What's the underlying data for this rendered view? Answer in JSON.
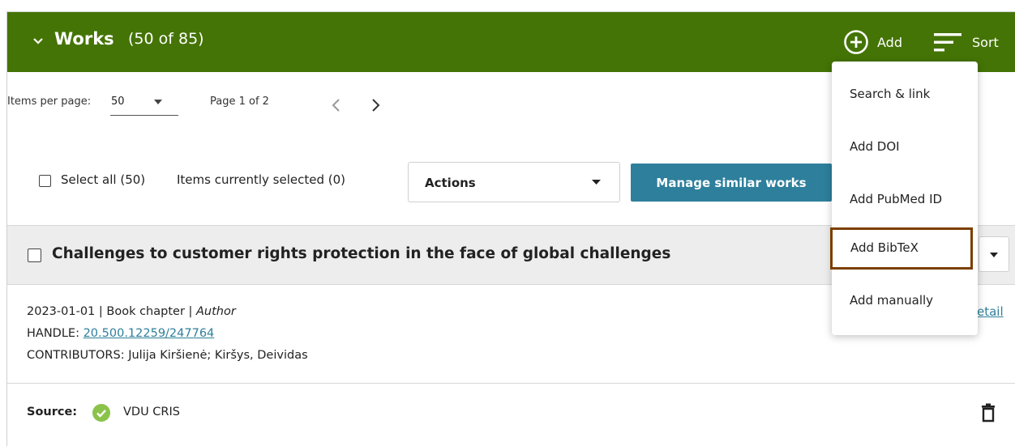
{
  "header": {
    "title": "Works",
    "count": "(50 of 85)",
    "add_label": "Add",
    "sort_label": "Sort",
    "color": "#447405"
  },
  "pagination": {
    "items_per_page_label": "Items per page:",
    "items_per_page_value": "50",
    "page_info": "Page 1 of 2"
  },
  "selection": {
    "select_all_label": "Select all (50)",
    "selected_info": "Items currently selected (0)",
    "actions_label": "Actions",
    "manage_label": "Manage similar works"
  },
  "work": {
    "title": "Challenges to customer rights protection in the face of global challenges",
    "date": "2023-01-01",
    "type": "Book chapter",
    "role": "Author",
    "handle_label": "HANDLE:",
    "handle_value": "20.500.12259/247764",
    "contributors_label": "CONTRIBUTORS:",
    "contributors": "Julija Kiršienė; Kiršys, Deividas",
    "detail_link": "etail",
    "source_label": "Source:",
    "source_name": "VDU CRIS"
  },
  "add_menu": {
    "items": [
      {
        "label": "Search & link"
      },
      {
        "label": "Add DOI"
      },
      {
        "label": "Add PubMed ID"
      },
      {
        "label": "Add BibTeX",
        "highlighted": true
      },
      {
        "label": "Add manually"
      }
    ]
  },
  "colors": {
    "link": "#2e7f9b",
    "highlight_border": "#7b3f00",
    "source_check": "#8bc34a"
  },
  "icons": [
    "chevron-down-icon",
    "add-circle-icon",
    "sort-icon",
    "chevron-left-icon",
    "chevron-right-icon",
    "caret-down-icon",
    "check-circle-icon",
    "trash-icon"
  ]
}
